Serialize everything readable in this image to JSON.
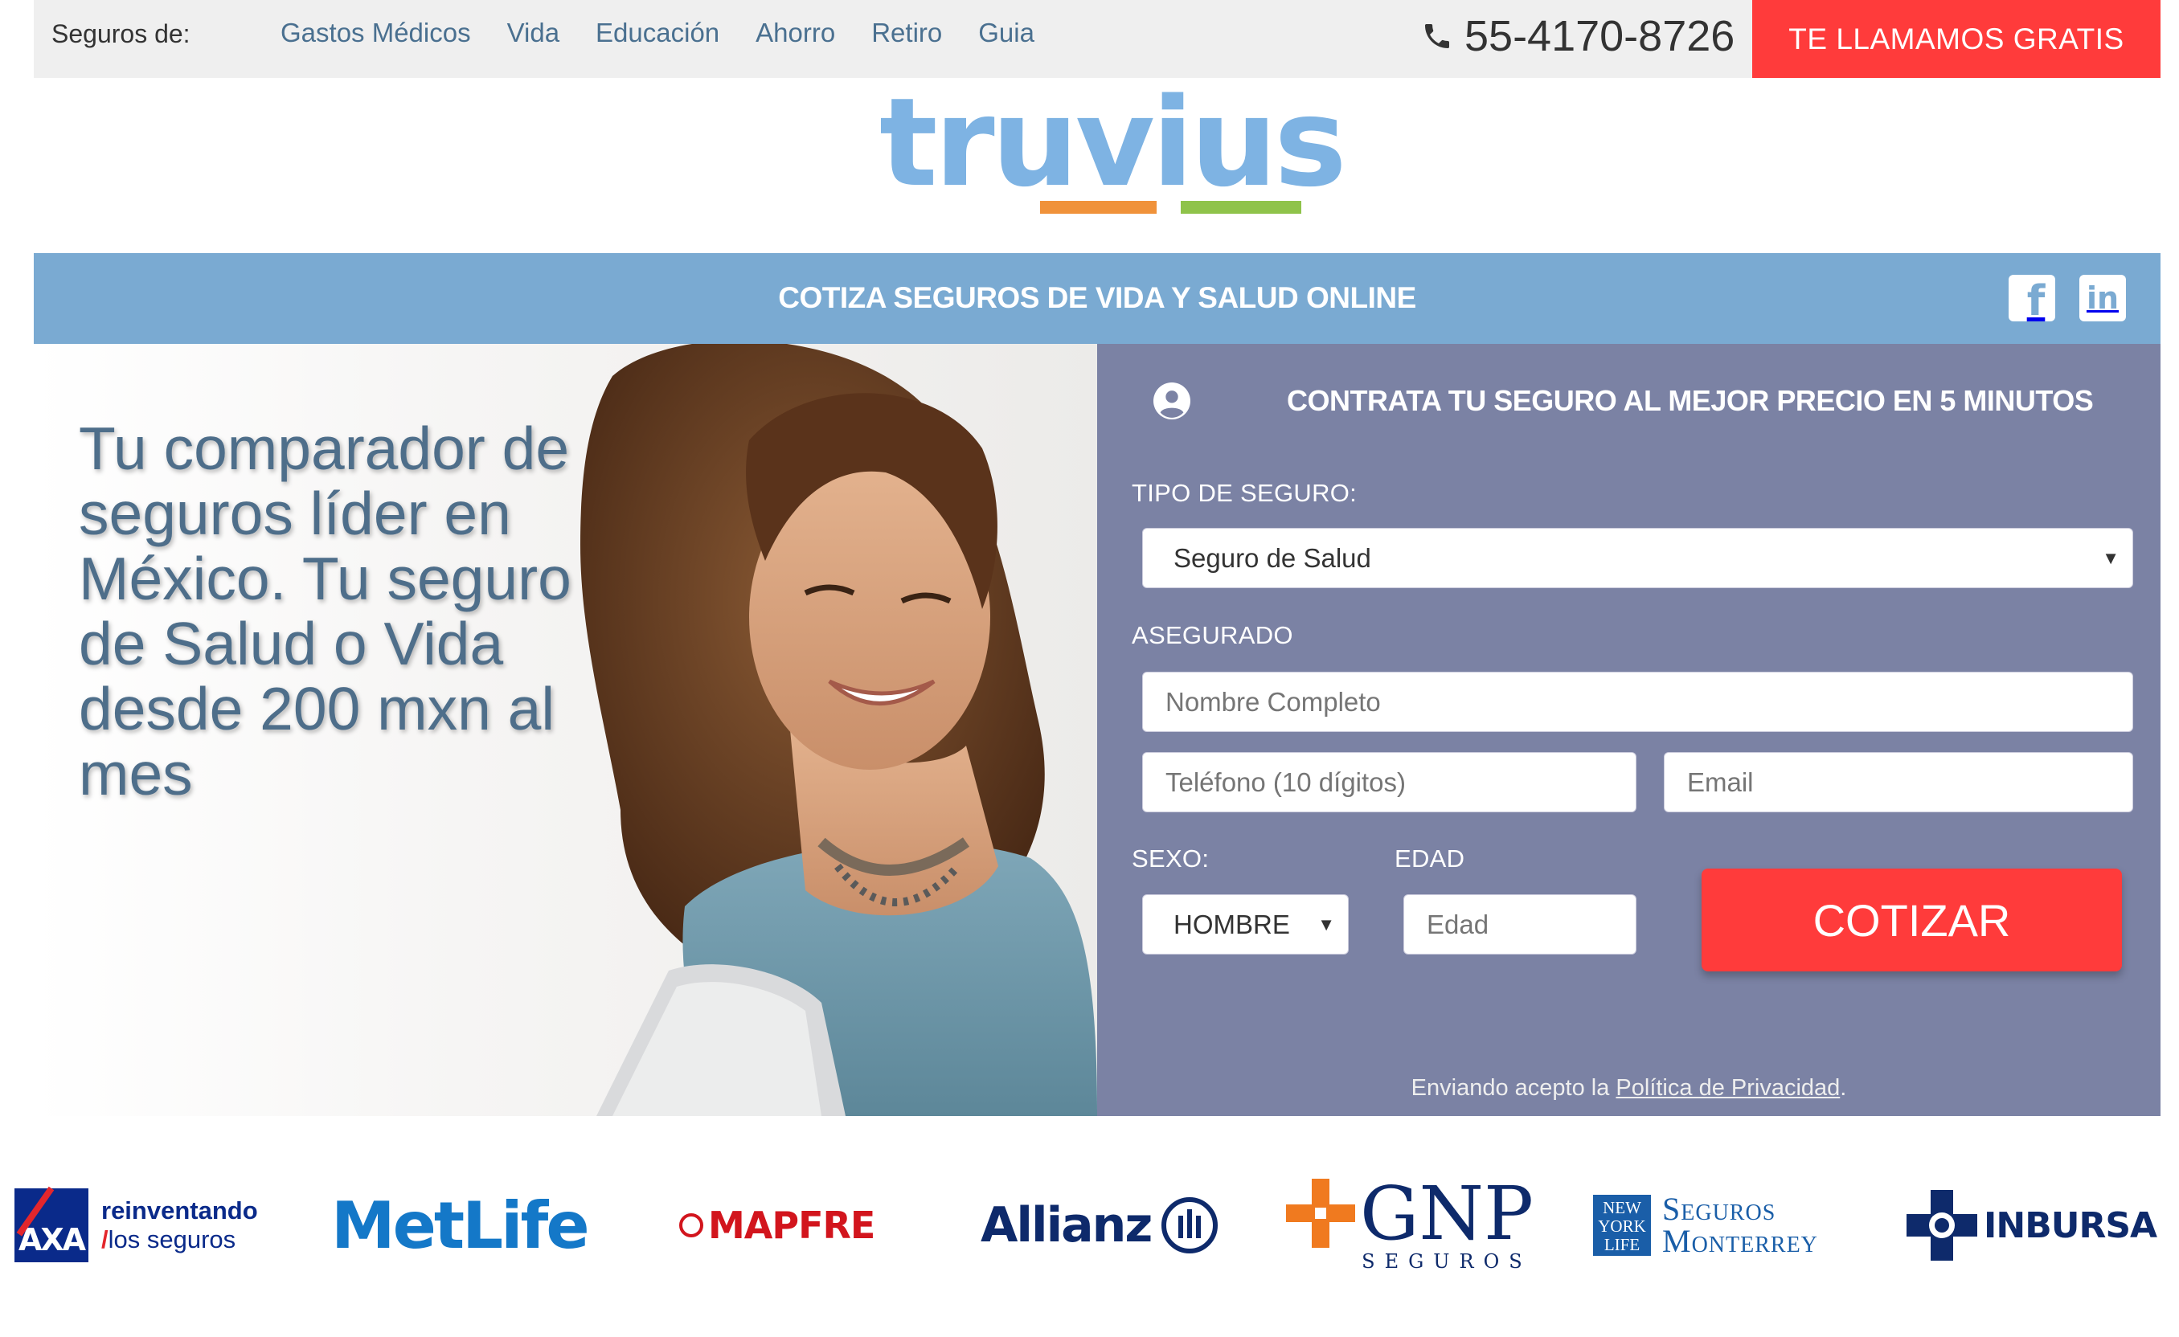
{
  "topbar": {
    "seguros_label": "Seguros de:",
    "nav": [
      "Gastos Médicos",
      "Vida",
      "Educación",
      "Ahorro",
      "Retiro",
      "Guia"
    ],
    "phone": "55-4170-8726",
    "call_button": "TE LLAMAMOS GRATIS"
  },
  "logo": {
    "text": "truvius",
    "bar_colors": [
      "#f0923a",
      "#8fc34a"
    ]
  },
  "band": {
    "title": "COTIZA SEGUROS DE VIDA Y SALUD ONLINE",
    "social": {
      "facebook": "f",
      "linkedin": "in"
    }
  },
  "hero": {
    "headline": "Tu comparador de seguros líder en México. Tu seguro de Salud o Vida desde 200 mxn al mes"
  },
  "form": {
    "title": "CONTRATA TU SEGURO AL MEJOR PRECIO EN 5 MINUTOS",
    "tipo_label": "TIPO DE SEGURO:",
    "tipo_value": "Seguro de Salud",
    "asegurado_label": "ASEGURADO",
    "nombre_placeholder": "Nombre Completo",
    "telefono_placeholder": "Teléfono (10 dígitos)",
    "email_placeholder": "Email",
    "sexo_label": "SEXO:",
    "sexo_value": "HOMBRE",
    "edad_label": "EDAD",
    "edad_placeholder": "Edad",
    "submit": "COTIZAR",
    "privacy_prefix": "Enviando acepto la ",
    "privacy_link": "Política de Privacidad",
    "privacy_suffix": "."
  },
  "partners": {
    "axa": {
      "mark": "AXA",
      "line1": "reinventando",
      "line2": "los seguros"
    },
    "metlife": "MetLife",
    "mapfre": "MAPFRE",
    "allianz": "Allianz",
    "gnp": {
      "name": "GNP",
      "sub": "SEGUROS"
    },
    "newyorklife": {
      "mark1": "NEW",
      "mark2": "YORK",
      "mark3": "LIFE",
      "line1": "Seguros",
      "line2": "Monterrey"
    },
    "inbursa": "INBURSA"
  },
  "colors": {
    "accent_red": "#ff3b3b",
    "band_blue": "#7aaad2",
    "form_panel": "#7b82a4",
    "nav_link": "#4a7090",
    "logo_blue": "#7eb3e3"
  }
}
